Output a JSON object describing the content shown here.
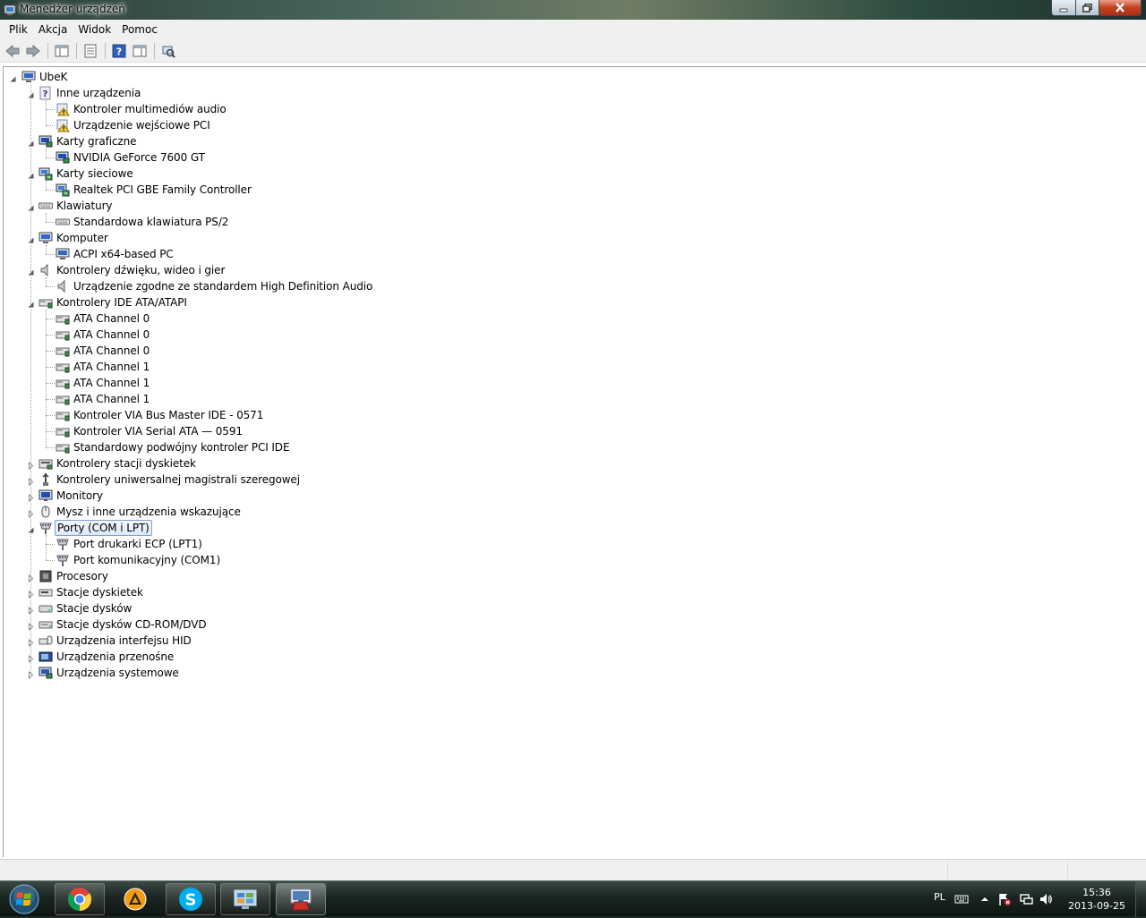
{
  "window": {
    "title": "Menedżer urządzeń"
  },
  "menu": {
    "items": [
      "Plik",
      "Akcja",
      "Widok",
      "Pomoc"
    ]
  },
  "toolbar": {
    "buttons": [
      "back-icon",
      "forward-icon",
      "console-tree-icon",
      "properties-icon",
      "help-icon",
      "action-pane-icon",
      "scan-hardware-icon"
    ]
  },
  "tree": {
    "root": "UbeK",
    "categories": [
      {
        "label": "Inne urządzenia",
        "icon": "unknown-device-icon",
        "expanded": true,
        "children": [
          {
            "label": "Kontroler multimediów audio",
            "icon": "warning-device-icon"
          },
          {
            "label": "Urządzenie wejściowe PCI",
            "icon": "warning-device-icon"
          }
        ]
      },
      {
        "label": "Karty graficzne",
        "icon": "display-adapter-icon",
        "expanded": true,
        "children": [
          {
            "label": "NVIDIA GeForce 7600 GT",
            "icon": "display-adapter-icon"
          }
        ]
      },
      {
        "label": "Karty sieciowe",
        "icon": "network-adapter-icon",
        "expanded": true,
        "children": [
          {
            "label": "Realtek PCI GBE Family Controller",
            "icon": "network-adapter-icon"
          }
        ]
      },
      {
        "label": "Klawiatury",
        "icon": "keyboard-icon",
        "expanded": true,
        "children": [
          {
            "label": "Standardowa klawiatura PS/2",
            "icon": "keyboard-icon"
          }
        ]
      },
      {
        "label": "Komputer",
        "icon": "computer-icon",
        "expanded": true,
        "children": [
          {
            "label": "ACPI x64-based PC",
            "icon": "computer-icon"
          }
        ]
      },
      {
        "label": "Kontrolery dźwięku, wideo i gier",
        "icon": "speaker-icon",
        "expanded": true,
        "children": [
          {
            "label": "Urządzenie zgodne ze standardem High Definition Audio",
            "icon": "speaker-icon"
          }
        ]
      },
      {
        "label": "Kontrolery IDE ATA/ATAPI",
        "icon": "ide-controller-icon",
        "expanded": true,
        "children": [
          {
            "label": "ATA Channel 0",
            "icon": "ide-controller-icon"
          },
          {
            "label": "ATA Channel 0",
            "icon": "ide-controller-icon"
          },
          {
            "label": "ATA Channel 0",
            "icon": "ide-controller-icon"
          },
          {
            "label": "ATA Channel 1",
            "icon": "ide-controller-icon"
          },
          {
            "label": "ATA Channel 1",
            "icon": "ide-controller-icon"
          },
          {
            "label": "ATA Channel 1",
            "icon": "ide-controller-icon"
          },
          {
            "label": "Kontroler VIA Bus Master IDE - 0571",
            "icon": "ide-controller-icon"
          },
          {
            "label": "Kontroler VIA Serial ATA — 0591",
            "icon": "ide-controller-icon"
          },
          {
            "label": "Standardowy podwójny kontroler PCI IDE",
            "icon": "ide-controller-icon"
          }
        ]
      },
      {
        "label": "Kontrolery stacji dyskietek",
        "icon": "floppy-controller-icon",
        "expanded": false,
        "children": []
      },
      {
        "label": "Kontrolery uniwersalnej magistrali szeregowej",
        "icon": "usb-icon",
        "expanded": false,
        "children": []
      },
      {
        "label": "Monitory",
        "icon": "monitor-icon",
        "expanded": false,
        "children": []
      },
      {
        "label": "Mysz i inne urządzenia wskazujące",
        "icon": "mouse-icon",
        "expanded": false,
        "children": []
      },
      {
        "label": "Porty (COM i LPT)",
        "icon": "port-icon",
        "expanded": true,
        "selected": true,
        "children": [
          {
            "label": "Port drukarki ECP (LPT1)",
            "icon": "port-icon"
          },
          {
            "label": "Port komunikacyjny (COM1)",
            "icon": "port-icon"
          }
        ]
      },
      {
        "label": "Procesory",
        "icon": "processor-icon",
        "expanded": false,
        "children": []
      },
      {
        "label": "Stacje dyskietek",
        "icon": "floppy-drive-icon",
        "expanded": false,
        "children": []
      },
      {
        "label": "Stacje dysków",
        "icon": "disk-drive-icon",
        "expanded": false,
        "children": []
      },
      {
        "label": "Stacje dysków CD-ROM/DVD",
        "icon": "cdrom-icon",
        "expanded": false,
        "children": []
      },
      {
        "label": "Urządzenia interfejsu HID",
        "icon": "hid-icon",
        "expanded": false,
        "children": []
      },
      {
        "label": "Urządzenia przenośne",
        "icon": "portable-device-icon",
        "expanded": false,
        "children": []
      },
      {
        "label": "Urządzenia systemowe",
        "icon": "system-device-icon",
        "expanded": false,
        "children": []
      }
    ]
  },
  "taskbar": {
    "apps": [
      "chrome-icon",
      "aimp-icon",
      "skype-icon",
      "control-panel-icon",
      "device-manager-icon"
    ]
  },
  "tray": {
    "language": "PL",
    "time": "15:36",
    "date": "2013-09-25"
  }
}
